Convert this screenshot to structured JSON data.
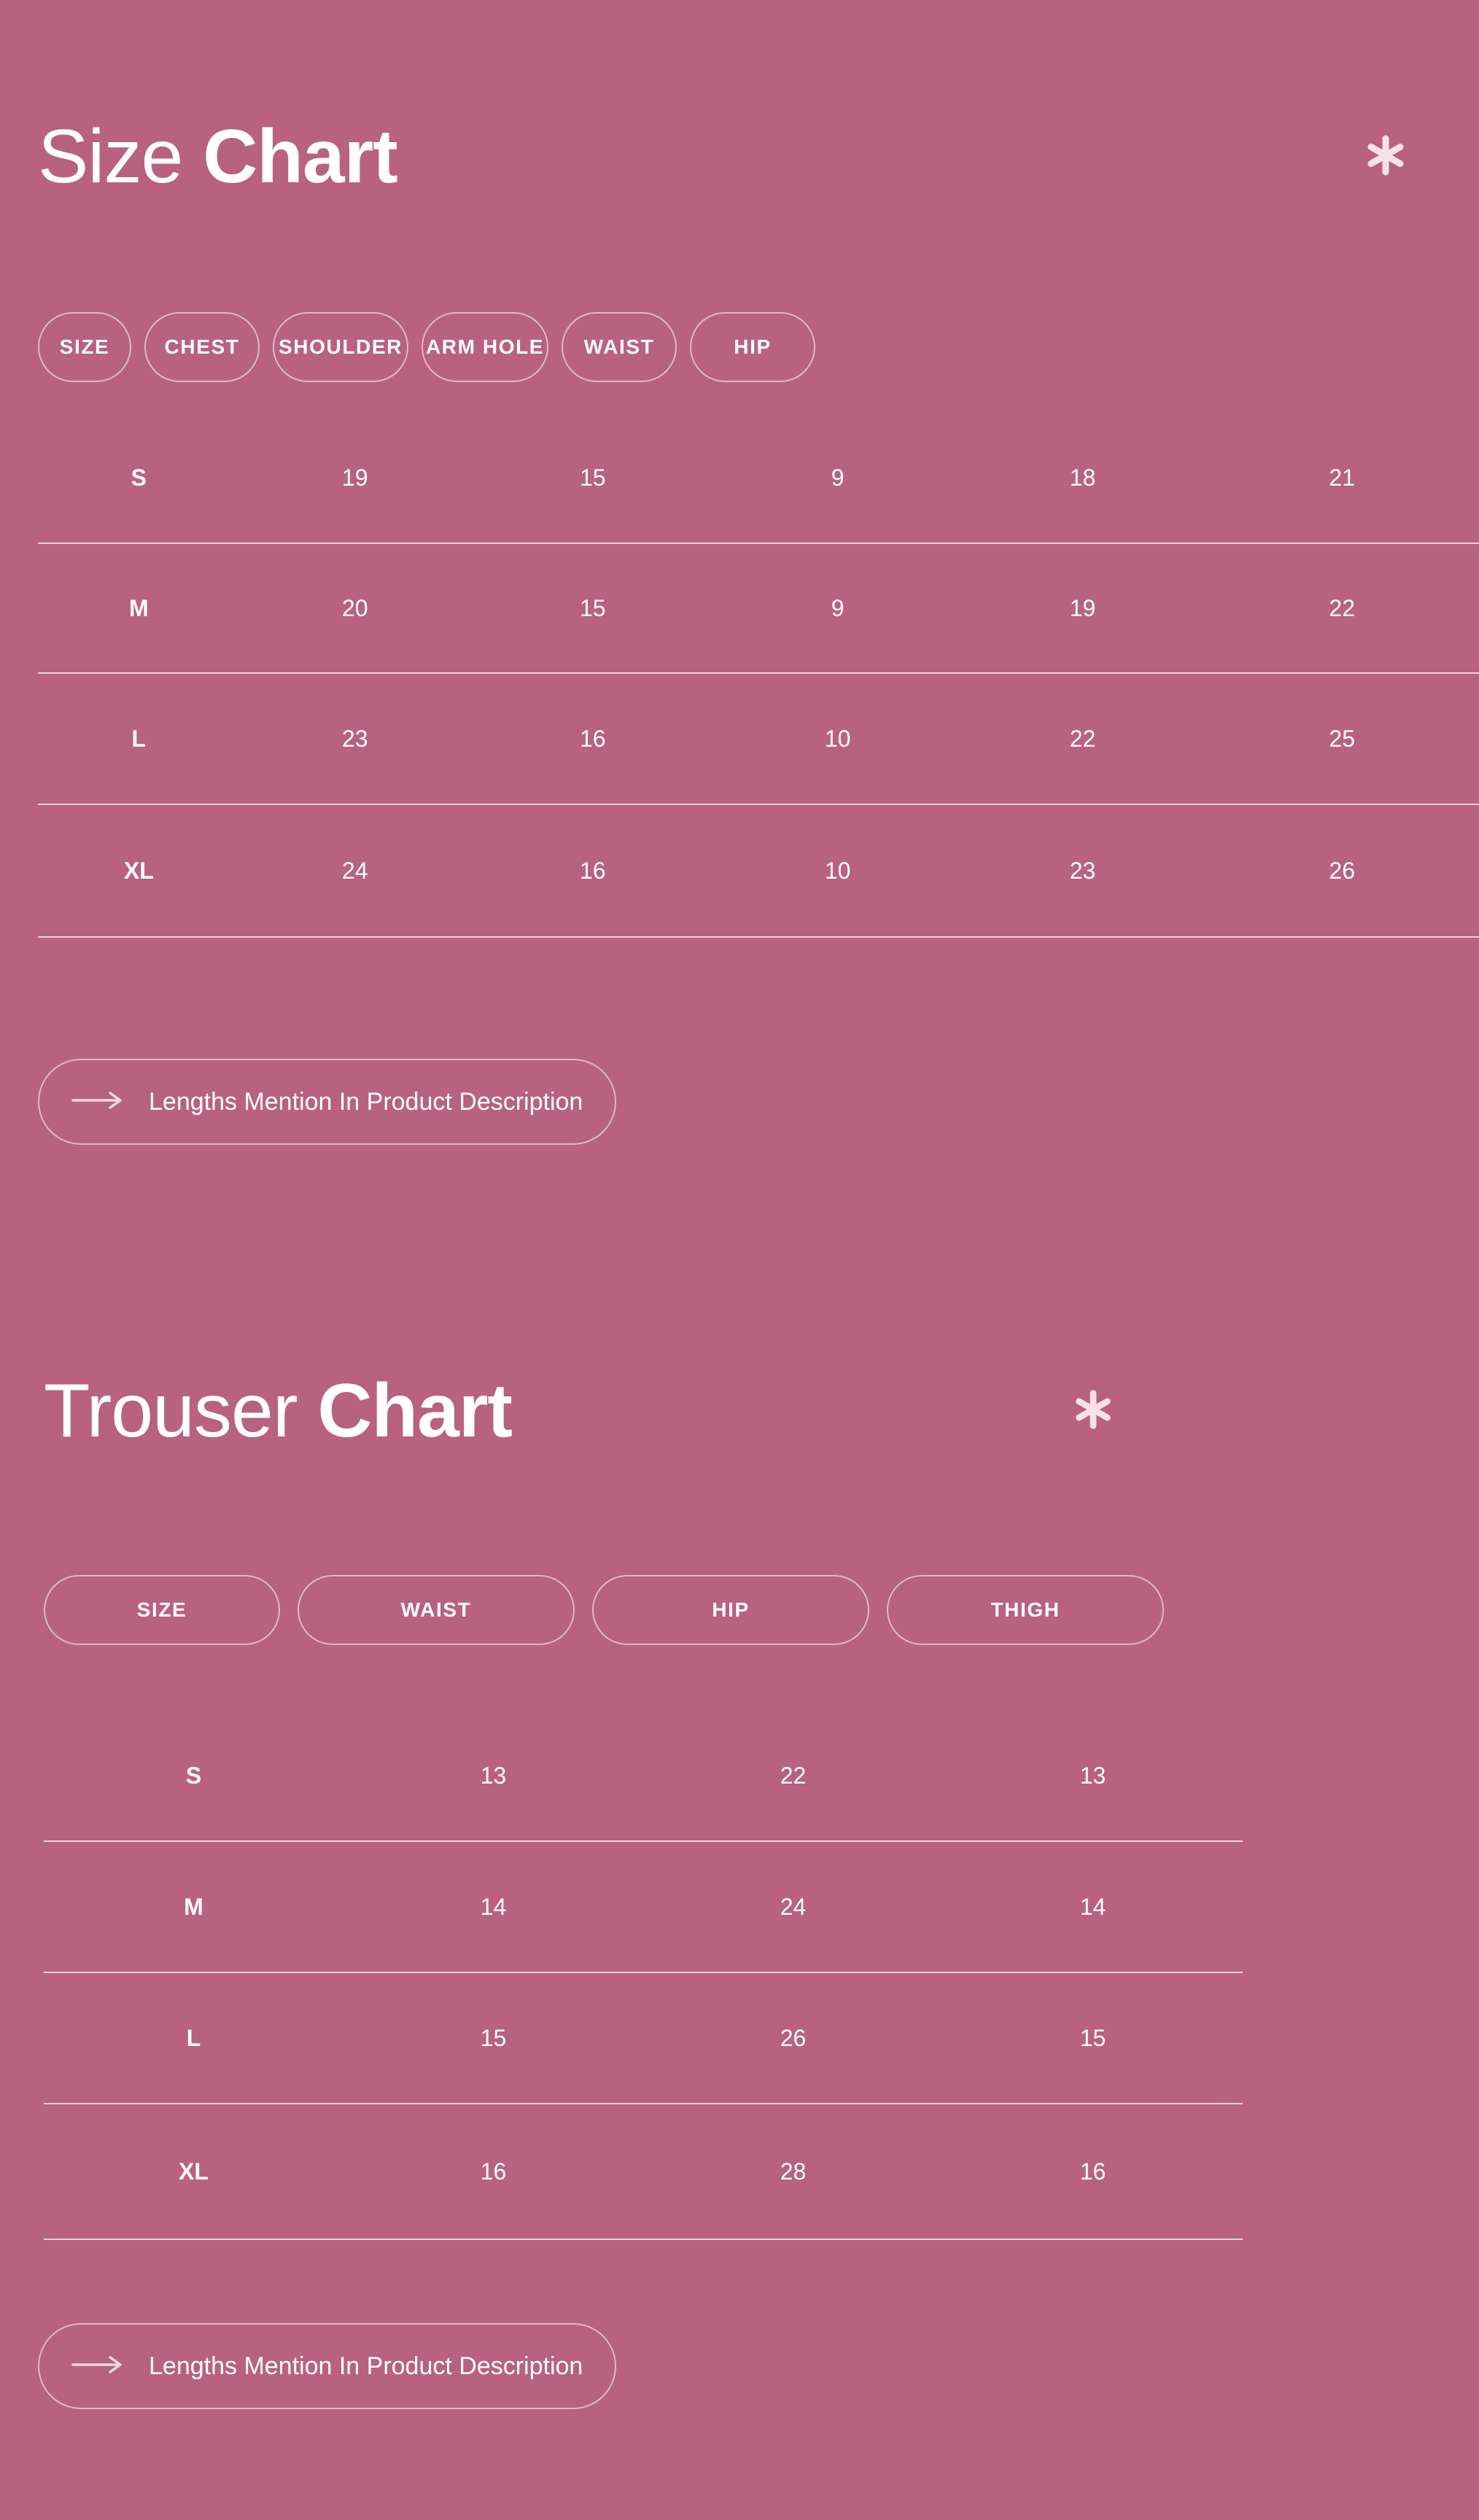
{
  "theme": {
    "background": "#b8627f",
    "text": "#ffffff",
    "border": "rgba(255,255,255,0.55)",
    "divider": "rgba(255,255,255,0.72)"
  },
  "sections": [
    {
      "id": "size-chart",
      "title_light": "Size",
      "title_bold": "Chart",
      "decoration_icon": "asterisk-icon",
      "note": {
        "icon": "arrow-right-icon",
        "label": "Lengths Mention In Product Description"
      },
      "columns": [
        "SIZE",
        "CHEST",
        "SHOULDER",
        "ARM HOLE",
        "WAIST",
        "HIP"
      ],
      "rows": [
        {
          "size": "S",
          "values": [
            "19",
            "15",
            "9",
            "18",
            "21"
          ]
        },
        {
          "size": "M",
          "values": [
            "20",
            "15",
            "9",
            "19",
            "22"
          ]
        },
        {
          "size": "L",
          "values": [
            "23",
            "16",
            "10",
            "22",
            "25"
          ]
        },
        {
          "size": "XL",
          "values": [
            "24",
            "16",
            "10",
            "23",
            "26"
          ]
        }
      ]
    },
    {
      "id": "trouser-chart",
      "title_light": "Trouser",
      "title_bold": "Chart",
      "decoration_icon": "asterisk-icon",
      "note": {
        "icon": "arrow-right-icon",
        "label": "Lengths Mention In Product Description"
      },
      "columns": [
        "SIZE",
        "WAIST",
        "HIP",
        "THIGH"
      ],
      "rows": [
        {
          "size": "S",
          "values": [
            "13",
            "22",
            "13"
          ]
        },
        {
          "size": "M",
          "values": [
            "14",
            "24",
            "14"
          ]
        },
        {
          "size": "L",
          "values": [
            "15",
            "26",
            "15"
          ]
        },
        {
          "size": "XL",
          "values": [
            "16",
            "28",
            "16"
          ]
        }
      ]
    }
  ],
  "chart_data": {
    "type": "table",
    "title": "Size Chart / Trouser Chart",
    "tables": [
      {
        "name": "Size Chart",
        "columns": [
          "SIZE",
          "CHEST",
          "SHOULDER",
          "ARM HOLE",
          "WAIST",
          "HIP"
        ],
        "rows": [
          [
            "S",
            19,
            15,
            9,
            18,
            21
          ],
          [
            "M",
            20,
            15,
            9,
            19,
            22
          ],
          [
            "L",
            23,
            16,
            10,
            22,
            25
          ],
          [
            "XL",
            24,
            16,
            10,
            23,
            26
          ]
        ],
        "note": "Lengths Mention In Product Description"
      },
      {
        "name": "Trouser Chart",
        "columns": [
          "SIZE",
          "WAIST",
          "HIP",
          "THIGH"
        ],
        "rows": [
          [
            "S",
            13,
            22,
            13
          ],
          [
            "M",
            14,
            24,
            14
          ],
          [
            "L",
            15,
            26,
            15
          ],
          [
            "XL",
            16,
            28,
            16
          ]
        ],
        "note": "Lengths Mention In Product Description"
      }
    ]
  }
}
